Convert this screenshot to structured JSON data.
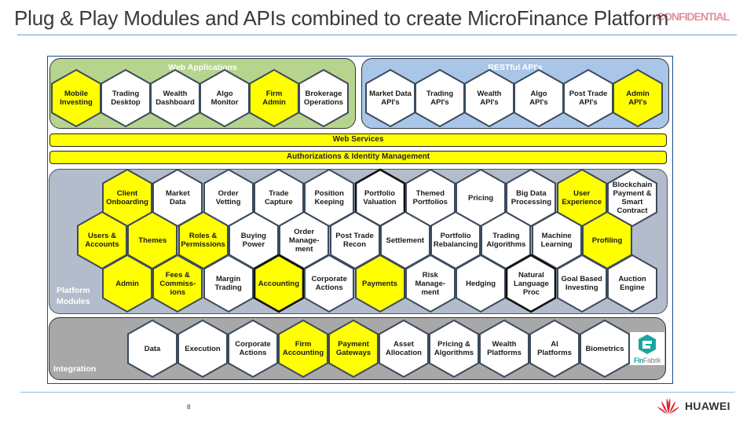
{
  "slide": {
    "title": "Plug & Play Modules and APIs combined to create MicroFinance Platform",
    "overlay_text": "CONFIDENTIAL",
    "page_number": "8",
    "brand": "HUAWEI",
    "colors": {
      "yellow": "#ffff00",
      "white": "#ffffff",
      "web_apps_panel": "#b6d48e",
      "restful_panel": "#a9c6e8",
      "platform_panel": "#b3bccb",
      "integration_panel": "#a8a8a8",
      "hex_stroke": "#3c4a5c",
      "huawei_red": "#e0242b"
    }
  },
  "web_applications": {
    "title": "Web Applications",
    "modules": [
      {
        "label": "Mobile\nInvesting",
        "highlight": true
      },
      {
        "label": "Trading\nDesktop",
        "highlight": false
      },
      {
        "label": "Wealth\nDashboard",
        "highlight": false
      },
      {
        "label": "Algo\nMonitor",
        "highlight": false
      },
      {
        "label": "Firm\nAdmin",
        "highlight": true
      },
      {
        "label": "Brokerage\nOperations",
        "highlight": false
      }
    ]
  },
  "restful_apis": {
    "title": "RESTful API's",
    "modules": [
      {
        "label": "Market Data\nAPI's",
        "highlight": false
      },
      {
        "label": "Trading\nAPI's",
        "highlight": false
      },
      {
        "label": "Wealth\nAPI's",
        "highlight": false
      },
      {
        "label": "Algo\nAPI's",
        "highlight": false
      },
      {
        "label": "Post Trade\nAPI's",
        "highlight": false
      },
      {
        "label": "Admin\nAPI's",
        "highlight": true
      }
    ]
  },
  "bars": {
    "web_services": "Web Services",
    "auth": "Authorizations & Identity Management"
  },
  "platform_modules": {
    "label": "Platform\nModules",
    "rows": [
      [
        {
          "label": "Client\nOnboarding",
          "highlight": true
        },
        {
          "label": "Market\nData",
          "highlight": false
        },
        {
          "label": "Order\nVetting",
          "highlight": false
        },
        {
          "label": "Trade\nCapture",
          "highlight": false
        },
        {
          "label": "Position\nKeeping",
          "highlight": false
        },
        {
          "label": "Portfolio\nValuation",
          "highlight": false,
          "bold_border": true
        },
        {
          "label": "Themed\nPortfolios",
          "highlight": false
        },
        {
          "label": "Pricing",
          "highlight": false
        },
        {
          "label": "Big Data\nProcessing",
          "highlight": false
        },
        {
          "label": "User\nExperience",
          "highlight": true
        },
        {
          "label": "Blockchain\nPayment &\nSmart\nContract",
          "highlight": false
        }
      ],
      [
        {
          "label": "Users &\nAccounts",
          "highlight": true
        },
        {
          "label": "Themes",
          "highlight": true
        },
        {
          "label": "Roles &\nPermissions",
          "highlight": true
        },
        {
          "label": "Buying\nPower",
          "highlight": false
        },
        {
          "label": "Order\nManage-\nment",
          "highlight": false
        },
        {
          "label": "Post Trade\nRecon",
          "highlight": false
        },
        {
          "label": "Settlement",
          "highlight": false
        },
        {
          "label": "Portfolio\nRebalancing",
          "highlight": false
        },
        {
          "label": "Trading\nAlgorithms",
          "highlight": false
        },
        {
          "label": "Machine\nLearning",
          "highlight": false
        },
        {
          "label": "Profiling",
          "highlight": true
        }
      ],
      [
        {
          "label": "Admin",
          "highlight": true
        },
        {
          "label": "Fees &\nCommiss-\nions",
          "highlight": true
        },
        {
          "label": "Margin\nTrading",
          "highlight": false
        },
        {
          "label": "Accounting",
          "highlight": true,
          "bold_border": true
        },
        {
          "label": "Corporate\nActions",
          "highlight": false
        },
        {
          "label": "Payments",
          "highlight": true
        },
        {
          "label": "Risk\nManage-\nment",
          "highlight": false
        },
        {
          "label": "Hedging",
          "highlight": false
        },
        {
          "label": "Natural\nLanguage\nProc",
          "highlight": false,
          "bold_border": true
        },
        {
          "label": "Goal Based\nInvesting",
          "highlight": false
        },
        {
          "label": "Auction\nEngine",
          "highlight": false
        }
      ]
    ]
  },
  "integration": {
    "label": "Integration",
    "modules": [
      {
        "label": "Data",
        "highlight": false
      },
      {
        "label": "Execution",
        "highlight": false
      },
      {
        "label": "Corporate\nActions",
        "highlight": false
      },
      {
        "label": "Firm\nAccounting",
        "highlight": true
      },
      {
        "label": "Payment\nGateways",
        "highlight": true
      },
      {
        "label": "Asset\nAllocation",
        "highlight": false
      },
      {
        "label": "Pricing &\nAlgorithms",
        "highlight": false
      },
      {
        "label": "Wealth\nPlatforms",
        "highlight": false
      },
      {
        "label": "AI\nPlatforms",
        "highlight": false
      },
      {
        "label": "Biometrics",
        "highlight": false
      }
    ],
    "logo": {
      "name_part1": "Fin",
      "name_part2": "Fabrik",
      "color1": "#1aa5a0",
      "color2": "#888888"
    }
  }
}
